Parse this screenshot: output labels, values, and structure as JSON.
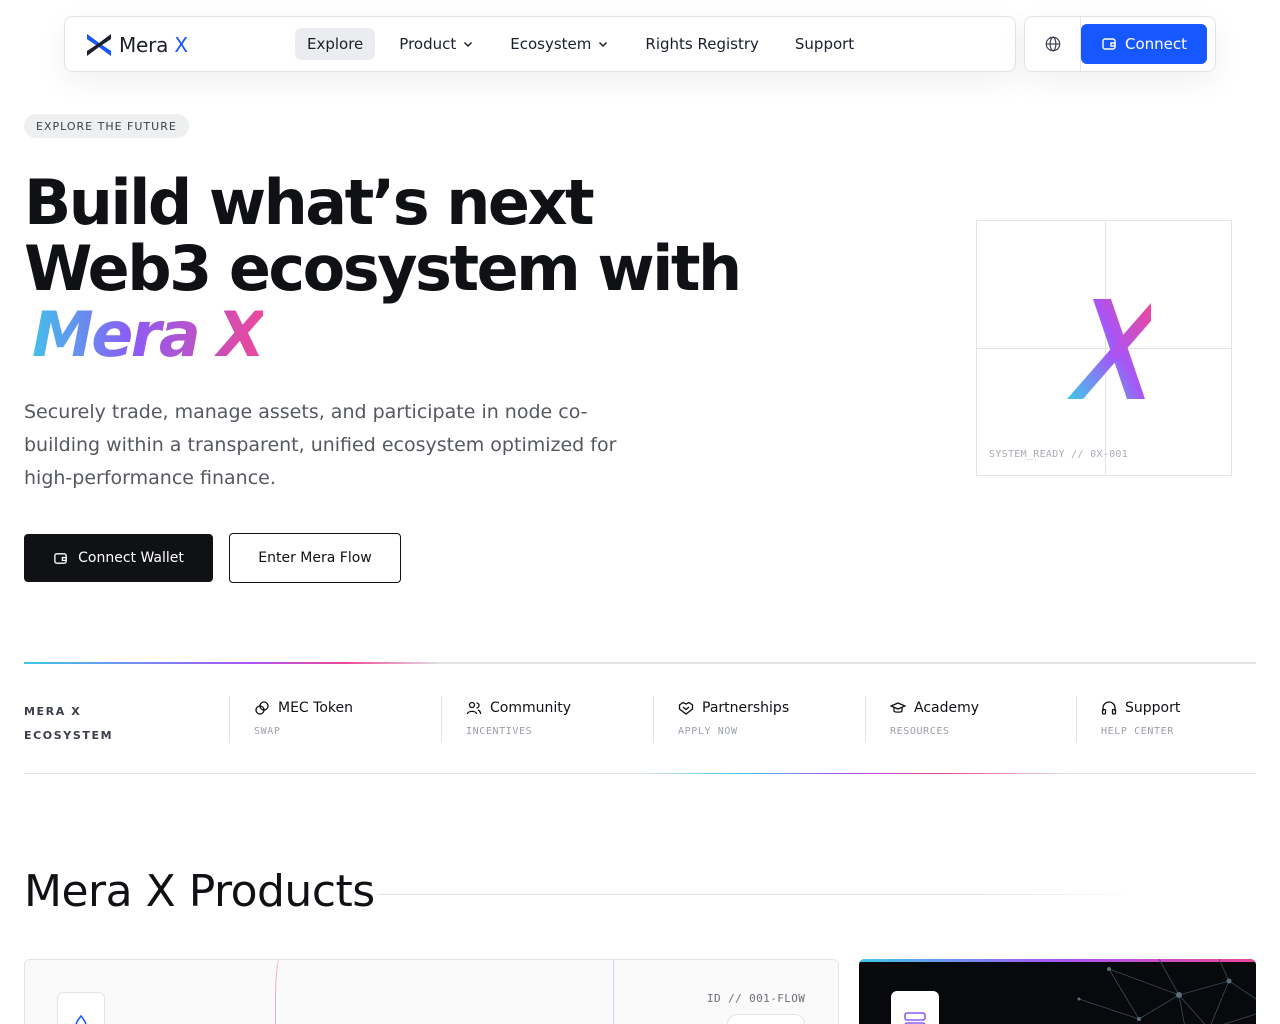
{
  "brand": {
    "name": "Mera",
    "name_accent": "X",
    "accent_color": "#1757ff"
  },
  "nav": {
    "items": [
      {
        "label": "Explore",
        "active": true,
        "dropdown": false
      },
      {
        "label": "Product",
        "active": false,
        "dropdown": true
      },
      {
        "label": "Ecosystem",
        "active": false,
        "dropdown": true
      },
      {
        "label": "Rights Registry",
        "active": false,
        "dropdown": false
      },
      {
        "label": "Support",
        "active": false,
        "dropdown": false
      }
    ],
    "language_icon": "globe-icon",
    "connect_label": "Connect"
  },
  "hero": {
    "eyebrow": "EXPLORE THE FUTURE",
    "headline_line1": "Build what’s next",
    "headline_line2": "Web3 ecosystem with",
    "headline_highlight": "Mera X",
    "subtext": "Securely trade, manage assets, and participate in node co-building within a transparent, unified ecosystem optimized for high-performance finance.",
    "primary_cta": "Connect Wallet",
    "secondary_cta": "Enter Mera Flow",
    "visual_status": "SYSTEM_READY // 0X-001",
    "gradient_colors": [
      "#3ec8e8",
      "#8b5cf6",
      "#ec4899"
    ]
  },
  "ecosystem": {
    "label_line1": "MERA X",
    "label_line2": "ECOSYSTEM",
    "items": [
      {
        "title": "MEC Token",
        "subtitle": "SWAP",
        "icon": "coins-icon"
      },
      {
        "title": "Community",
        "subtitle": "INCENTIVES",
        "icon": "users-icon"
      },
      {
        "title": "Partnerships",
        "subtitle": "APPLY NOW",
        "icon": "handshake-icon"
      },
      {
        "title": "Academy",
        "subtitle": "RESOURCES",
        "icon": "graduation-cap-icon"
      },
      {
        "title": "Support",
        "subtitle": "HELP CENTER",
        "icon": "headphones-icon"
      }
    ]
  },
  "products": {
    "title": "Mera X Products",
    "card1_id": "ID // 001-FLOW",
    "card1_icon": "droplet-icon",
    "card2_icon": "server-icon"
  }
}
